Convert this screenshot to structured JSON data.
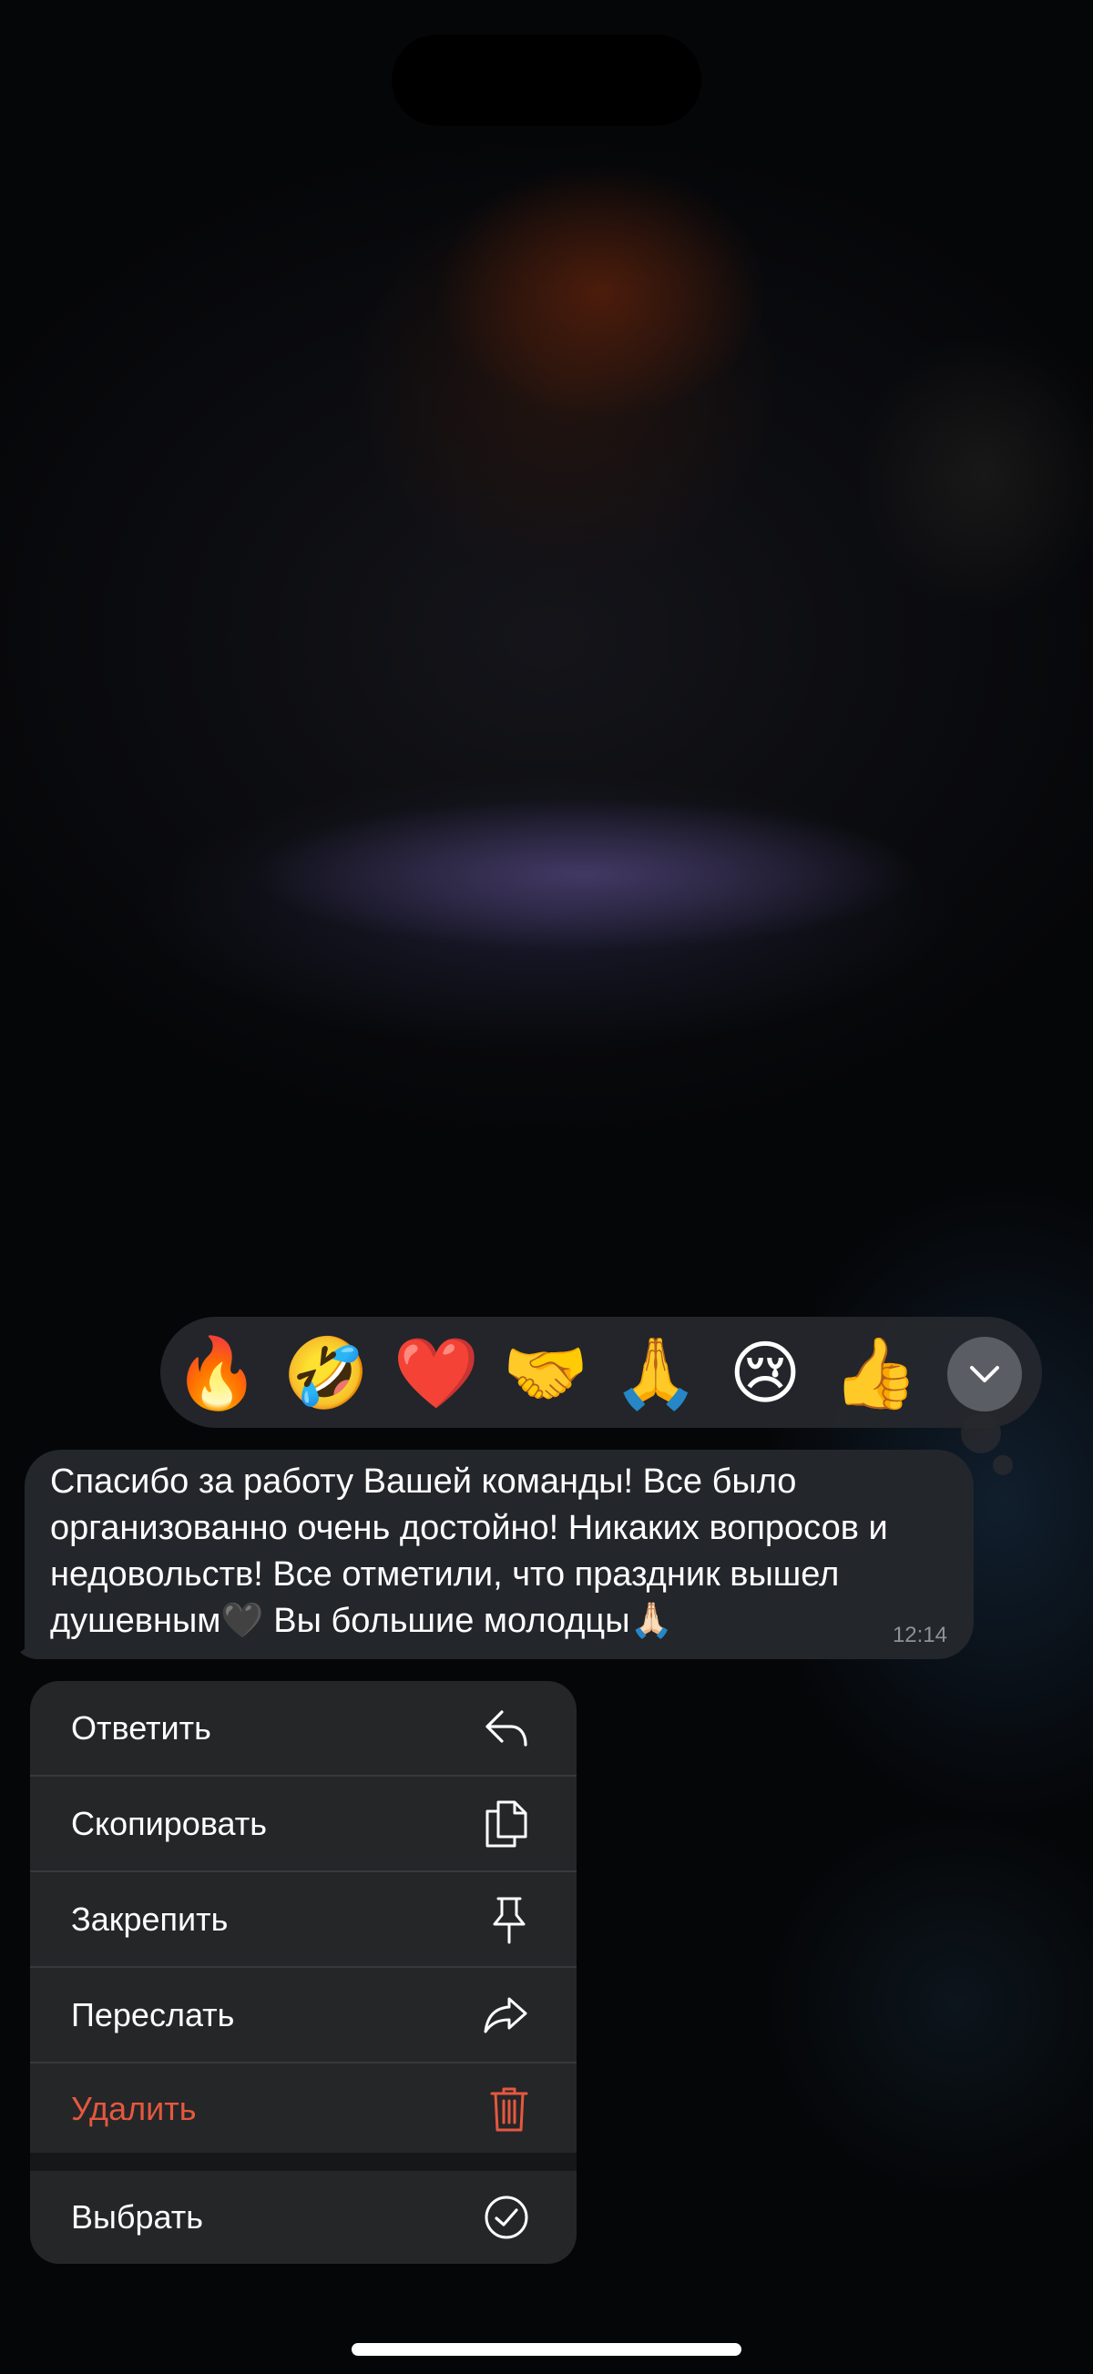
{
  "reactions": {
    "emojis": [
      "🔥",
      "🤣",
      "❤️",
      "🤝",
      "🙏",
      "😢",
      "👍"
    ],
    "expand_icon": "chevron-down-icon"
  },
  "message": {
    "text_lines": [
      "Спасибо за работу Вашей команды! Все было",
      "организованно очень достойно! Никаких вопросов и",
      "недовольств! Все отметили, что праздник вышел",
      "душевным🖤 Вы большие молодцы🙏🏻"
    ],
    "time": "12:14",
    "colors": {
      "bubble": "#23262b",
      "time": "#8e9297"
    }
  },
  "menu": {
    "items": [
      {
        "label": "Ответить",
        "icon": "reply-icon"
      },
      {
        "label": "Скопировать",
        "icon": "copy-icon"
      },
      {
        "label": "Закрепить",
        "icon": "pin-icon"
      },
      {
        "label": "Переслать",
        "icon": "forward-icon"
      },
      {
        "label": "Удалить",
        "icon": "trash-icon",
        "destructive": true
      },
      {
        "label": "Выбрать",
        "icon": "checkmark-circle-icon"
      }
    ],
    "colors": {
      "background": "#252628",
      "destructive": "#e5583f"
    }
  }
}
